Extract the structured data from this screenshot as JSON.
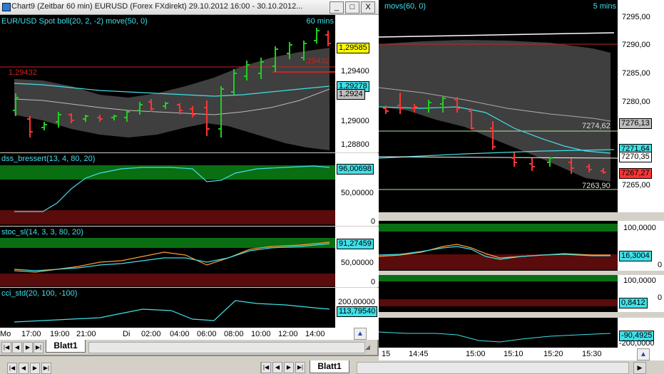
{
  "left_window": {
    "title": "Chart9 (Zeitbar 60 min)  EURUSD (Forex FXdirekt) 29.10.2012 16:00 - 30.10.2012...",
    "buttons": [
      "_",
      "□",
      "X"
    ],
    "panes": {
      "price": {
        "label": "EUR/USD Spot boll(20, 2, -2) move(50, 0)",
        "timeframe": "60 mins",
        "ticks": [
          "1,29400",
          "1,29000",
          "1,28800"
        ],
        "price_tags": [
          "1,29585",
          "1,29278",
          "1,2924"
        ],
        "line_label": "1,29432",
        "line_label_right": ",29432"
      },
      "dss": {
        "label": "dss_bressert(13, 4, 80, 20)",
        "ticks": [
          "50,00000",
          "0"
        ],
        "value_tag": "96,00698"
      },
      "stoc": {
        "label": "stoc_sl(14, 3, 3, 80, 20)",
        "ticks": [
          "50,00000",
          "0"
        ],
        "value_tag": "91,27459"
      },
      "cci": {
        "label": "cci_std(20, 100, -100)",
        "ticks": [
          "200,00000"
        ],
        "value_tag": "113,79540"
      }
    },
    "time_labels": [
      "Mo",
      "17:00",
      "19:00",
      "21:00",
      "Di",
      "02:00",
      "04:00",
      "06:00",
      "08:00",
      "10:00",
      "12:00",
      "14:00"
    ],
    "sheet_tab": "Blatt1"
  },
  "right_window": {
    "price": {
      "label": "movs(60, 0)",
      "timeframe": "5 mins",
      "ticks": [
        "7295,00",
        "7290,00",
        "7285,00",
        "7280,00",
        "7265,00"
      ],
      "price_tags": [
        "7276,13",
        "7271,64",
        "7270,35",
        "7267,27"
      ],
      "line_labels": [
        "7274,62",
        "7263,90"
      ]
    },
    "ind1": {
      "ticks": [
        "100,0000",
        "0"
      ],
      "value_tag": "16,3004"
    },
    "ind2": {
      "ticks": [
        "100,0000",
        "0"
      ],
      "value_tag": "0,8412"
    },
    "ind3": {
      "ticks": [
        "-90,4925",
        "-200,0000"
      ]
    },
    "time_labels": [
      "15",
      "14:45",
      "15:00",
      "15:10",
      "15:20",
      "15:30"
    ],
    "sheet_tab": "Blatt1"
  },
  "colors": {
    "background": "#000000",
    "green_zone": "#0a6e12",
    "red_zone": "#6e0a0a",
    "cyan": "#40e0e8",
    "orange": "#ff9933",
    "label_cyan": "#40e0e8",
    "yellow_tag": "#ffff00"
  }
}
